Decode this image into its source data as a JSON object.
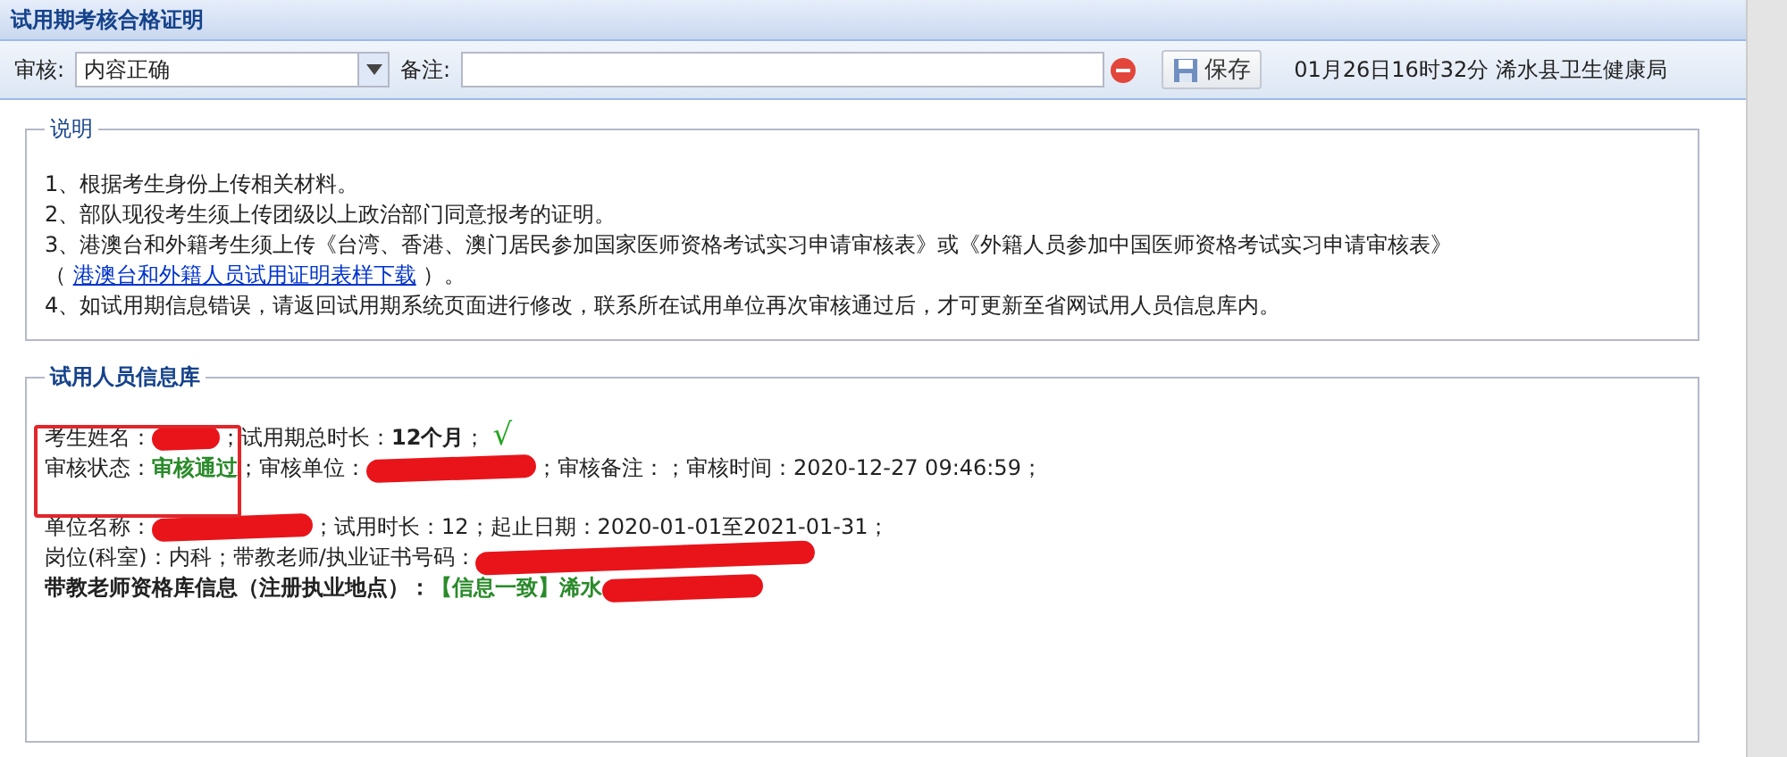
{
  "window": {
    "title": "试用期考核合格证明"
  },
  "toolbar": {
    "review_label": "审核:",
    "review_value": "内容正确",
    "note_label": "备注:",
    "save_button": "保存",
    "timestamp": "01月26日16时32分 浠水县卫生健康局"
  },
  "notes": {
    "legend": "说明",
    "items": [
      {
        "segments": [
          {
            "kind": "text",
            "text": "1、根据考生身份上传相关材料。"
          }
        ]
      },
      {
        "segments": [
          {
            "kind": "text",
            "text": "2、部队现役考生须上传团级以上政治部门同意报考的证明。"
          }
        ]
      },
      {
        "segments": [
          {
            "kind": "text",
            "text": "3、港澳台和外籍考生须上传《台湾、香港、澳门居民参加国家医师资格考试实习申请审核表》或《外籍人员参加中国医师资格考试实习申请审核表》"
          }
        ]
      },
      {
        "segments": [
          {
            "kind": "text",
            "text": "（ "
          },
          {
            "kind": "link",
            "text": "港澳台和外籍人员试用证明表样下载"
          },
          {
            "kind": "text",
            "text": " ）。"
          }
        ]
      },
      {
        "segments": [
          {
            "kind": "text",
            "text": "4、如试用期信息错误，请返回试用期系统页面进行修改，联系所在试用单位再次审核通过后，才可更新至省网试用人员信息库内。"
          }
        ]
      }
    ]
  },
  "info": {
    "legend": "试用人员信息库",
    "groups": [
      [
        {
          "segments": [
            {
              "kind": "text",
              "text": "考生姓名："
            },
            {
              "kind": "redacted"
            },
            {
              "kind": "text",
              "text": "；试用期总时长："
            },
            {
              "kind": "bold",
              "text": "12个月"
            },
            {
              "kind": "text",
              "text": "；"
            },
            {
              "kind": "check",
              "text": "√"
            }
          ]
        },
        {
          "segments": [
            {
              "kind": "text",
              "text": "审核状态："
            },
            {
              "kind": "green",
              "text": "审核通过"
            },
            {
              "kind": "text",
              "text": "；审核单位："
            },
            {
              "kind": "redacted"
            },
            {
              "kind": "text",
              "text": "；审核备注：；审核时间：2020-12-27 09:46:59；"
            }
          ]
        }
      ],
      [
        {
          "segments": [
            {
              "kind": "text",
              "text": "单位名称："
            },
            {
              "kind": "redacted"
            },
            {
              "kind": "text",
              "text": "；试用时长：12；起止日期：2020-01-01至2021-01-31；"
            }
          ]
        },
        {
          "segments": [
            {
              "kind": "text",
              "text": "岗位(科室)：内科；带教老师/执业证书号码："
            },
            {
              "kind": "redacted"
            }
          ]
        },
        {
          "segments": [
            {
              "kind": "bold",
              "text": "带教老师资格库信息（注册执业地点）："
            },
            {
              "kind": "green",
              "text": "【信息一致】浠水"
            },
            {
              "kind": "redacted"
            }
          ]
        }
      ]
    ],
    "highlight": {
      "shown": true
    }
  }
}
